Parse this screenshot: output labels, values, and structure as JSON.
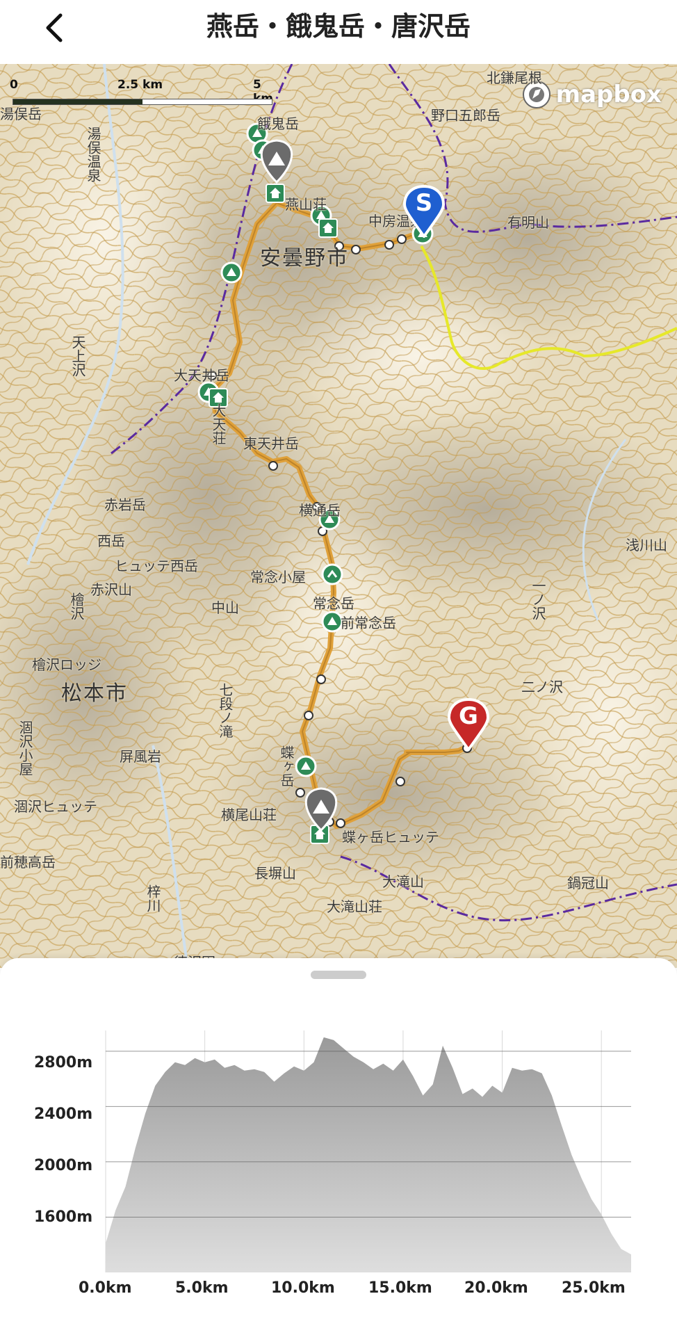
{
  "header": {
    "title": "燕岳・餓鬼岳・唐沢岳"
  },
  "map": {
    "attribution": "mapbox",
    "scale": {
      "labels": [
        "0",
        "2.5 km",
        "5 km"
      ]
    },
    "cities": [
      "安曇野市",
      "松本市"
    ],
    "places": [
      "湯俣岳",
      "湯俣温泉",
      "北鎌尾根",
      "野口五郎岳",
      "燕山荘",
      "中房温泉",
      "餓鬼岳",
      "有明山",
      "天上沢",
      "大天井岳",
      "大天荘",
      "東天井岳",
      "赤岩岳",
      "横通岳",
      "ヒュッテ西岳",
      "西岳",
      "赤沢山",
      "浅川山",
      "常念小屋",
      "常念岳",
      "前常念岳",
      "中山",
      "檜沢",
      "檜沢ロッジ",
      "一ノ沢",
      "二ノ沢",
      "七段ノ滝",
      "屏風岩",
      "涸沢小屋",
      "涸沢ヒュッテ",
      "蝶ヶ岳",
      "横尾山荘",
      "蝶ヶ岳ヒュッテ",
      "大滝山",
      "大滝山荘",
      "長塀山",
      "前穂高岳",
      "梓川",
      "鍋冠山",
      "徳沢園"
    ],
    "colors": {
      "route": "#e0a13a",
      "start": "#1f5fd0",
      "goal": "#c62828",
      "hut": "#2e8b57",
      "boundary": "#5a2aa0",
      "trail_yellow": "#e6e82a"
    },
    "markers": {
      "start": "S",
      "goal": "G"
    },
    "icons": [
      "peak-icon",
      "hut-icon",
      "camp-icon",
      "waypoint-icon"
    ]
  },
  "elevation_profile": {
    "y_ticks": [
      "2800m",
      "2400m",
      "2000m",
      "1600m"
    ],
    "x_ticks": [
      "0.0km",
      "5.0km",
      "10.0km",
      "15.0km",
      "20.0km",
      "25.0km"
    ],
    "chart_data": {
      "type": "area",
      "x": [
        0,
        0.5,
        1,
        1.5,
        2,
        2.5,
        3,
        3.5,
        4,
        4.5,
        5,
        5.5,
        6,
        6.5,
        7,
        7.5,
        8,
        8.5,
        9,
        9.5,
        10,
        10.5,
        11,
        11.5,
        12,
        12.5,
        13,
        13.5,
        14,
        14.5,
        15,
        15.5,
        16,
        16.5,
        17,
        17.5,
        18,
        18.5,
        19,
        19.5,
        20,
        20.5,
        21,
        21.5,
        22,
        22.5,
        23,
        23.5,
        24,
        24.5,
        25,
        25.5,
        26,
        26.5
      ],
      "y": [
        1410,
        1650,
        1820,
        2100,
        2350,
        2550,
        2650,
        2720,
        2700,
        2750,
        2720,
        2740,
        2680,
        2700,
        2660,
        2670,
        2650,
        2580,
        2640,
        2690,
        2660,
        2720,
        2900,
        2880,
        2820,
        2760,
        2720,
        2670,
        2710,
        2660,
        2740,
        2620,
        2480,
        2560,
        2840,
        2680,
        2490,
        2530,
        2470,
        2550,
        2500,
        2680,
        2660,
        2670,
        2640,
        2480,
        2260,
        2050,
        1880,
        1730,
        1620,
        1480,
        1370,
        1330
      ],
      "xlim": [
        0,
        26.5
      ],
      "ylim": [
        1200,
        2950
      ],
      "xlabel": "",
      "ylabel": ""
    }
  }
}
